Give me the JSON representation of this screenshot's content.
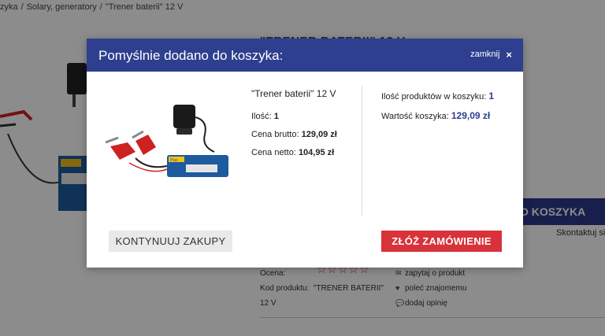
{
  "background": {
    "breadcrumb": [
      "zyka",
      "/",
      "Solary, generatory",
      "/",
      "\"Trener baterii\" 12 V"
    ],
    "product_title": "\"TRENER BATERII\" 12 V",
    "cart_button_label": "O KOSZYKA",
    "contact_text": "Skontaktuj się",
    "meta_left": {
      "rating_label": "Ocena:",
      "code_label": "Kod produktu:",
      "code_value": "\"TRENER BATERII\"",
      "code_suffix": "12 V"
    },
    "stars": "☆☆☆☆☆",
    "meta_right": [
      {
        "icon": "envelope-icon",
        "label": "zapytaj o produkt"
      },
      {
        "icon": "heart-icon",
        "label": "poleć znajomemu"
      },
      {
        "icon": "comments-icon",
        "label": "dodaj opinię"
      }
    ]
  },
  "modal": {
    "title": "Pomyślnie dodano do koszyka:",
    "close_label": "zamknij",
    "close_icon": "×",
    "product": {
      "name": "\"Trener baterii\" 12 V",
      "qty_label": "Ilość:",
      "qty_value": "1",
      "gross_label": "Cena brutto:",
      "gross_value": "129,09 zł",
      "net_label": "Cena netto:",
      "net_value": "104,95 zł",
      "image_brand": "Plus"
    },
    "cart": {
      "count_label": "Ilość produktów w koszyku:",
      "count_value": "1",
      "total_label": "Wartość koszyka:",
      "total_value": "129,09 zł"
    },
    "continue_label": "KONTYNUUJ ZAKUPY",
    "order_label": "ZŁÓŻ ZAMÓWIENIE"
  },
  "colors": {
    "header_blue": "#2d3f8e",
    "order_red": "#d8323a",
    "continue_gray": "#e9e9e9"
  }
}
